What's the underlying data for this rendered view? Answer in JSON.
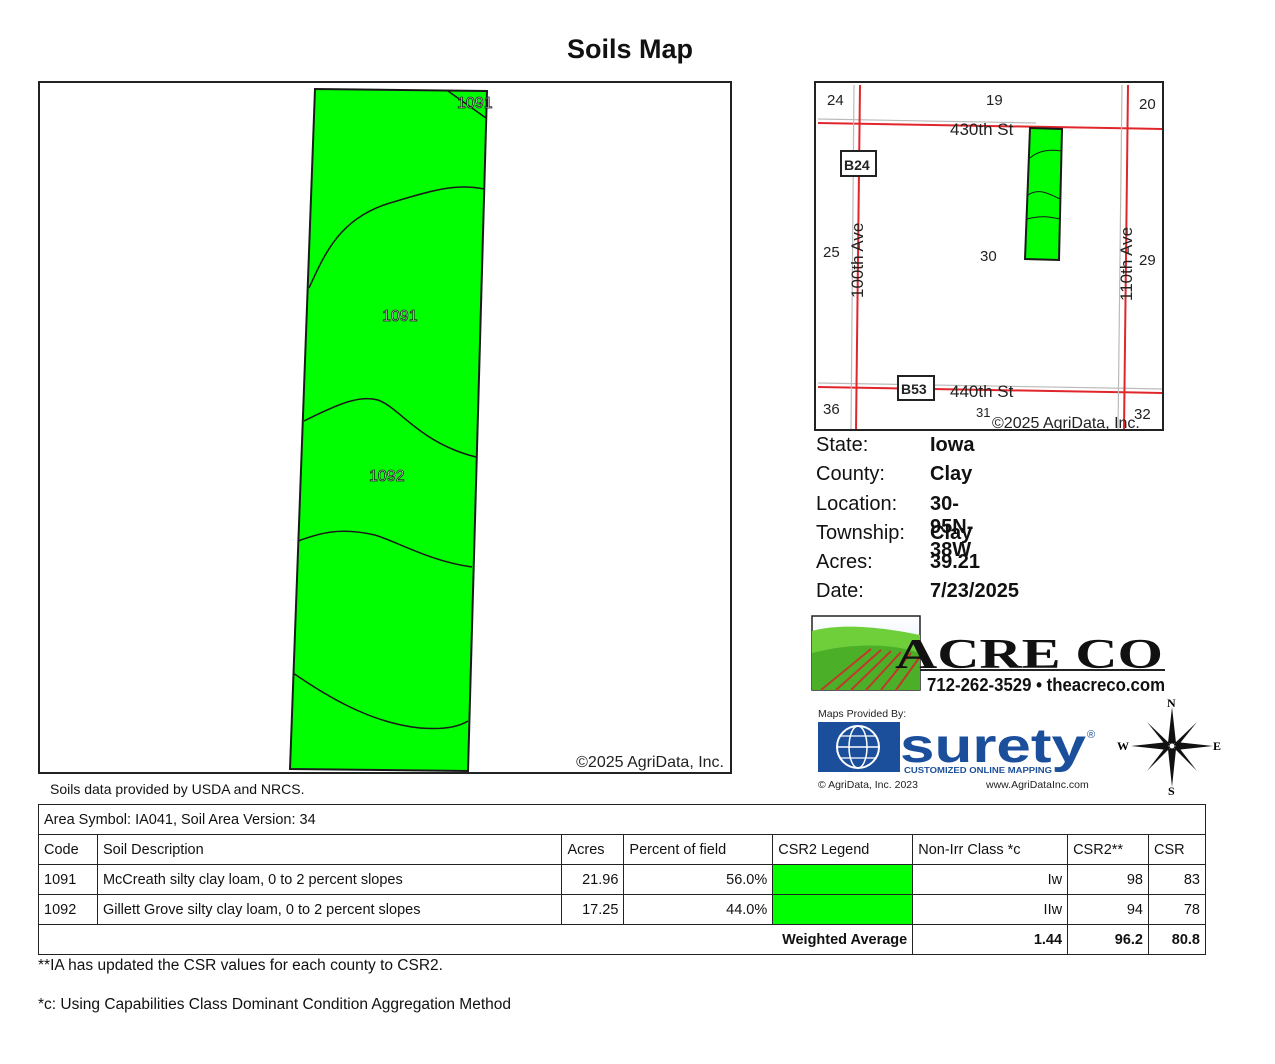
{
  "title": "Soils Map",
  "main_map": {
    "labels": [
      {
        "text": "1091"
      },
      {
        "text": "1091"
      },
      {
        "text": "1092"
      }
    ],
    "copyright": "©2025 AgriData, Inc.",
    "field_color": "#00ff00"
  },
  "source_note": "Soils data provided by USDA and NRCS.",
  "locator_map": {
    "section_numbers": [
      "24",
      "19",
      "20",
      "25",
      "30",
      "29",
      "36",
      "31",
      "32"
    ],
    "roads": {
      "north": "430th St",
      "south": "440th St",
      "west": "100th Ave",
      "east": "110th Ave"
    },
    "highway_shields": [
      "B24",
      "B53"
    ],
    "copyright": "©2025 AgriData, Inc.",
    "road_color": "#e0262b"
  },
  "info": [
    {
      "label": "State:",
      "value": "Iowa"
    },
    {
      "label": "County:",
      "value": "Clay"
    },
    {
      "label": "Location:",
      "value": "30-95N-38W"
    },
    {
      "label": "Township:",
      "value": "Clay"
    },
    {
      "label": "Acres:",
      "value": "39.21"
    },
    {
      "label": "Date:",
      "value": "7/23/2025"
    }
  ],
  "acreco": {
    "logo_text": "ACRE CO",
    "contact": "712-262-3529 • theacreco.com"
  },
  "surety": {
    "provided_by": "Maps Provided By:",
    "brand": "surety",
    "registered": "®",
    "tagline": "CUSTOMIZED ONLINE MAPPING",
    "copyright": "© AgriData, Inc. 2023",
    "website": "www.AgriDataInc.com"
  },
  "compass": {
    "n": "N",
    "s": "S",
    "e": "E",
    "w": "W"
  },
  "table": {
    "area_symbol": "Area Symbol: IA041, Soil Area Version: 34",
    "headers": [
      "Code",
      "Soil Description",
      "Acres",
      "Percent of field",
      "CSR2 Legend",
      "Non-Irr Class *c",
      "CSR2**",
      "CSR"
    ],
    "rows": [
      {
        "code": "1091",
        "description": "McCreath silty clay loam, 0 to 2 percent slopes",
        "acres": "21.96",
        "percent": "56.0%",
        "nonirr": "Iw",
        "csr2": "98",
        "csr": "83"
      },
      {
        "code": "1092",
        "description": "Gillett Grove silty clay loam, 0 to 2 percent slopes",
        "acres": "17.25",
        "percent": "44.0%",
        "nonirr": "IIw",
        "csr2": "94",
        "csr": "78"
      }
    ],
    "weighted_label": "Weighted Average",
    "weighted_nonirr": "1.44",
    "weighted_csr2": "96.2",
    "weighted_csr": "80.8"
  },
  "footnotes": [
    "**IA has updated the CSR values for each county to CSR2.",
    "*c: Using Capabilities Class Dominant Condition Aggregation Method"
  ]
}
